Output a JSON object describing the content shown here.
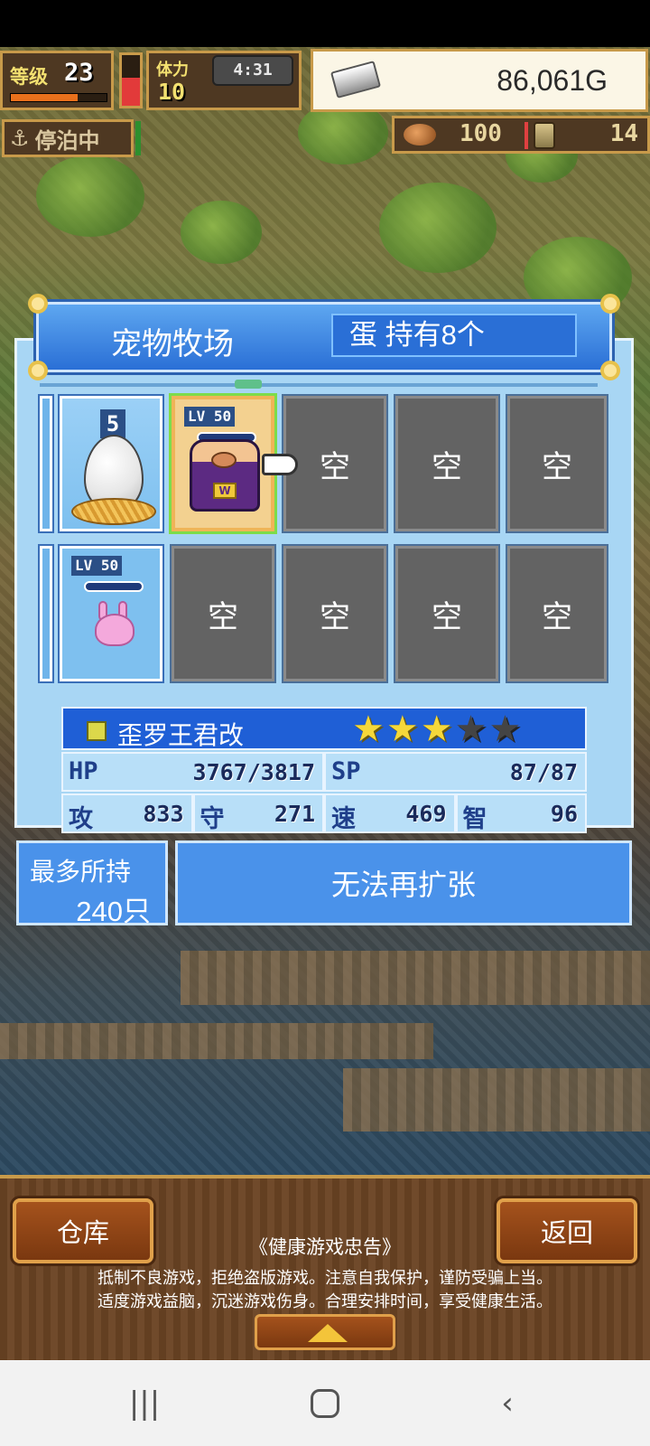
{
  "hud": {
    "level_label": "等级",
    "level_value": "23",
    "level_progress": 0.7,
    "stamina_label": "体力",
    "stamina_value": "10",
    "stamina_level": 0.55,
    "clock": "4:31",
    "gold": "86,061G",
    "anchor_label": "停泊中",
    "food_value": "100",
    "coin_value": "14"
  },
  "ranch": {
    "title": "宠物牧场",
    "egg_count": "蛋 持有8个",
    "egg_slot_number": "5",
    "selected_pet_lv": "LV 50",
    "second_pet_lv": "LV 50",
    "king_emblem": "W",
    "empty_label": "空",
    "empty_slots": [
      "空",
      "空",
      "空",
      "空",
      "空",
      "空",
      "空"
    ]
  },
  "pet_info": {
    "name": "歪罗王君改",
    "stars_filled": 3,
    "stars_total": 5,
    "stats": [
      {
        "key": "HP",
        "value": "3767/3817"
      },
      {
        "key": "SP",
        "value": "87/87"
      },
      {
        "key": "攻",
        "value": "833"
      },
      {
        "key": "守",
        "value": "271"
      },
      {
        "key": "速",
        "value": "469"
      },
      {
        "key": "智",
        "value": "96"
      }
    ]
  },
  "capacity": {
    "label": "最多所持",
    "value": "240只"
  },
  "expand_label": "无法再扩张",
  "bottom": {
    "storage_label": "仓库",
    "back_label": "返回",
    "advisory_title": "《健康游戏忠告》",
    "advisory_line1": "抵制不良游戏，拒绝盗版游戏。注意自我保护，谨防受骗上当。",
    "advisory_line2": "适度游戏益脑，沉迷游戏伤身。合理安排时间，享受健康生活。"
  },
  "navbar": {
    "recents_icon": "recents-icon",
    "home_icon": "home-icon",
    "back_icon": "back-icon"
  },
  "colors": {
    "panel": "#a8d6f4",
    "header": "#2a6fd6",
    "wood": "#6b4424",
    "gold_border": "#c89a4a"
  }
}
